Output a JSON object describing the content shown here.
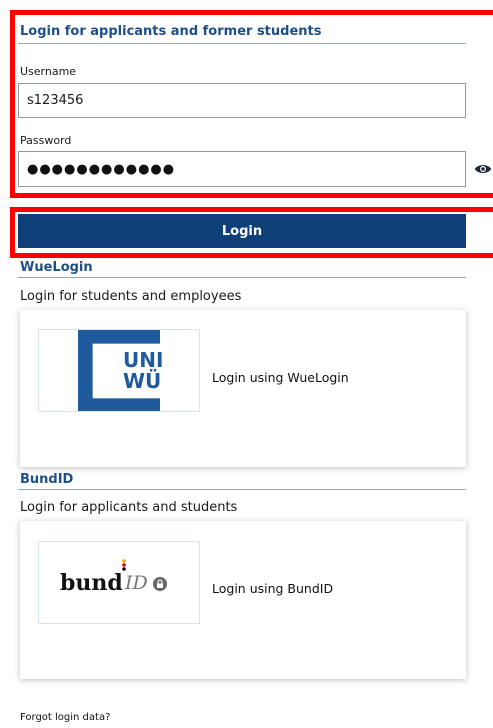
{
  "applicant_login": {
    "title": "Login for applicants and former students",
    "username_label": "Username",
    "username_value": "s123456",
    "password_label": "Password",
    "password_masked": "●●●●●●●●●●●●",
    "login_label": "Login"
  },
  "wuelogin": {
    "title": "WueLogin",
    "subtitle": "Login for students and employees",
    "card_text": "Login using WueLogin",
    "logo_line1": "UNI",
    "logo_line2": "WÜ"
  },
  "bundid": {
    "title": "BundID",
    "subtitle": "Login for applicants and students",
    "card_text": "Login using BundID",
    "logo_word": "bund",
    "logo_id": "ID"
  },
  "footer": {
    "forgot_link": "Forgot login data?"
  },
  "colors": {
    "primary": "#0f3f78",
    "highlight": "#ff0000",
    "title": "#1f4f8a"
  }
}
